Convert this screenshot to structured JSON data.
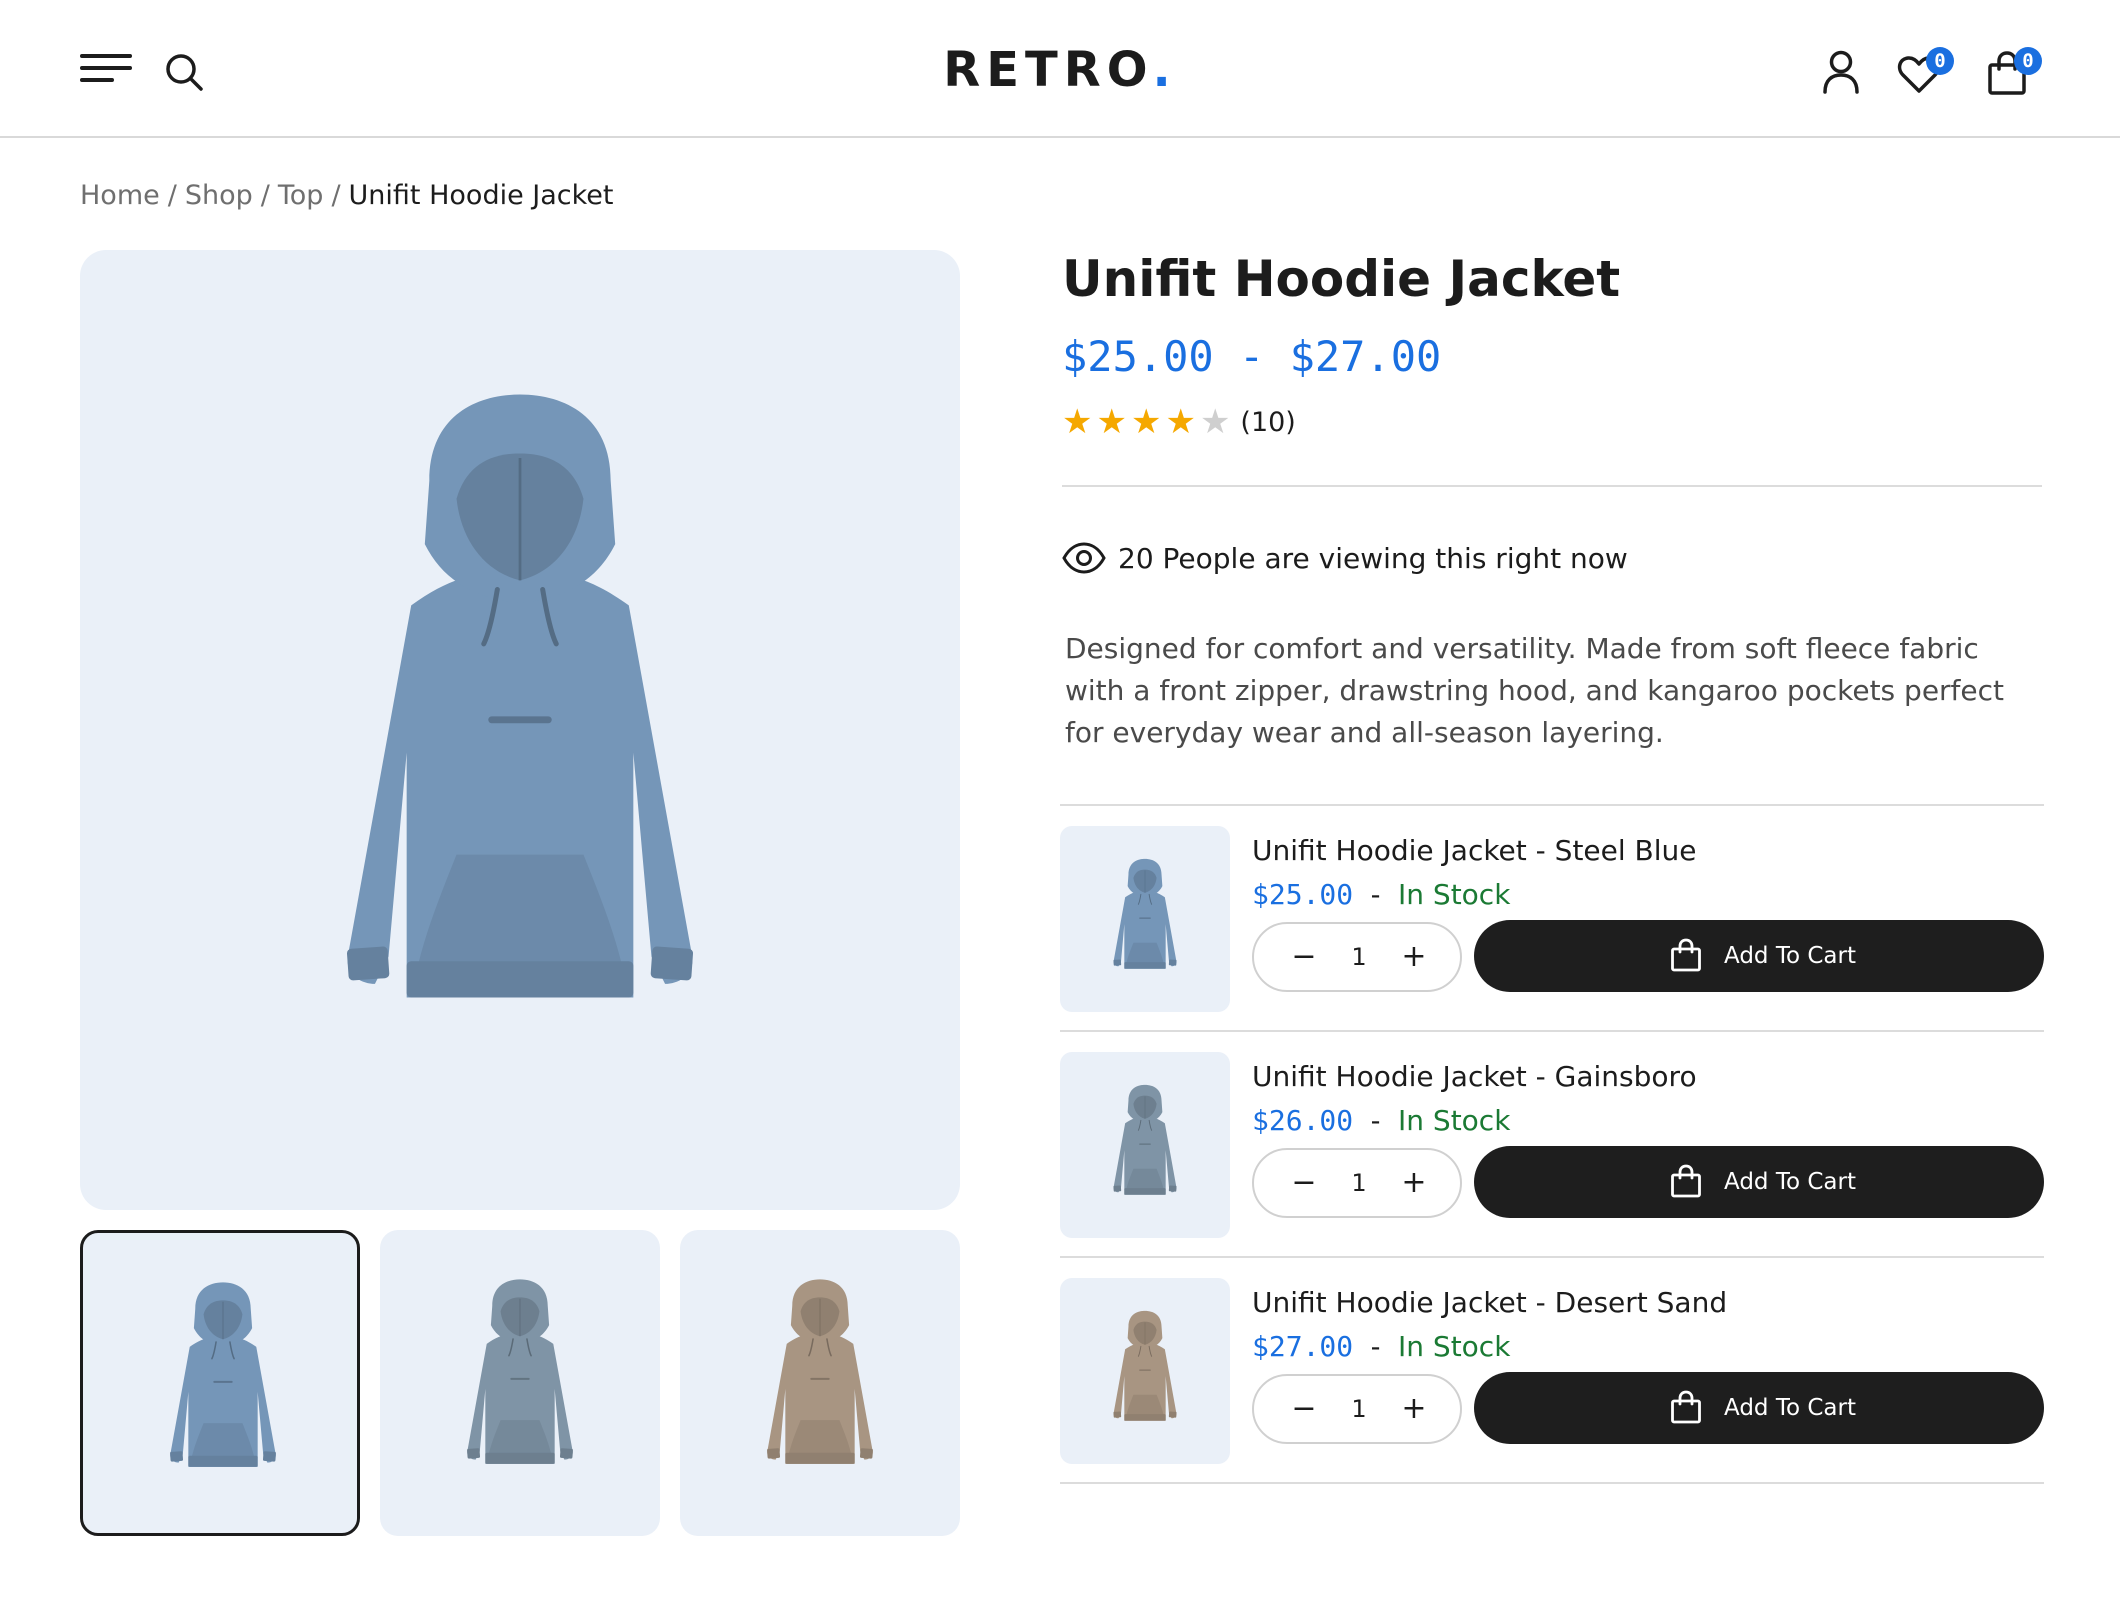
{
  "header": {
    "logo_text": "RETRO",
    "logo_dot": ".",
    "wishlist_count": "0",
    "cart_count": "0"
  },
  "breadcrumb": {
    "items": [
      "Home",
      "Shop",
      "Top"
    ],
    "separator": "/",
    "current": "Unifit Hoodie Jacket"
  },
  "product": {
    "title": "Unifit Hoodie Jacket",
    "price_range": "$25.00 - $27.00",
    "rating": 4,
    "rating_max": 5,
    "review_count": "(10)",
    "viewers_text": "20 People are viewing this right now",
    "description": "Designed for comfort and versatility. Made from soft fleece fabric with a front zipper, drawstring hood, and kangaroo pockets perfect for everyday wear and all-season layering."
  },
  "gallery": {
    "main_color": "#7596b8",
    "thumbs": [
      {
        "color": "#7596b8",
        "active": true
      },
      {
        "color": "#7f94a6",
        "active": false
      },
      {
        "color": "#a89582",
        "active": false
      }
    ]
  },
  "variants": [
    {
      "name": "Unifit Hoodie Jacket - Steel Blue",
      "price": "$25.00",
      "dash": "-",
      "stock": "In Stock",
      "qty": "1",
      "button": "Add To Cart",
      "color": "#7596b8"
    },
    {
      "name": "Unifit Hoodie Jacket - Gainsboro",
      "price": "$26.00",
      "dash": "-",
      "stock": "In Stock",
      "qty": "1",
      "button": "Add To Cart",
      "color": "#7f94a6"
    },
    {
      "name": "Unifit Hoodie Jacket - Desert Sand",
      "price": "$27.00",
      "dash": "-",
      "stock": "In Stock",
      "qty": "1",
      "button": "Add To Cart",
      "color": "#a89582"
    }
  ],
  "colors": {
    "accent": "#1a6fe0",
    "in_stock": "#1b7a34",
    "star": "#f5a800",
    "button_bg": "#1e1e1e",
    "image_bg": "#eaf0f8"
  },
  "icons": {
    "menu": "hamburger-menu-icon",
    "search": "search-icon",
    "account": "user-icon",
    "wishlist": "heart-icon",
    "cart": "shopping-bag-icon",
    "viewers": "eye-icon",
    "add_to_cart": "shopping-bag-icon"
  }
}
